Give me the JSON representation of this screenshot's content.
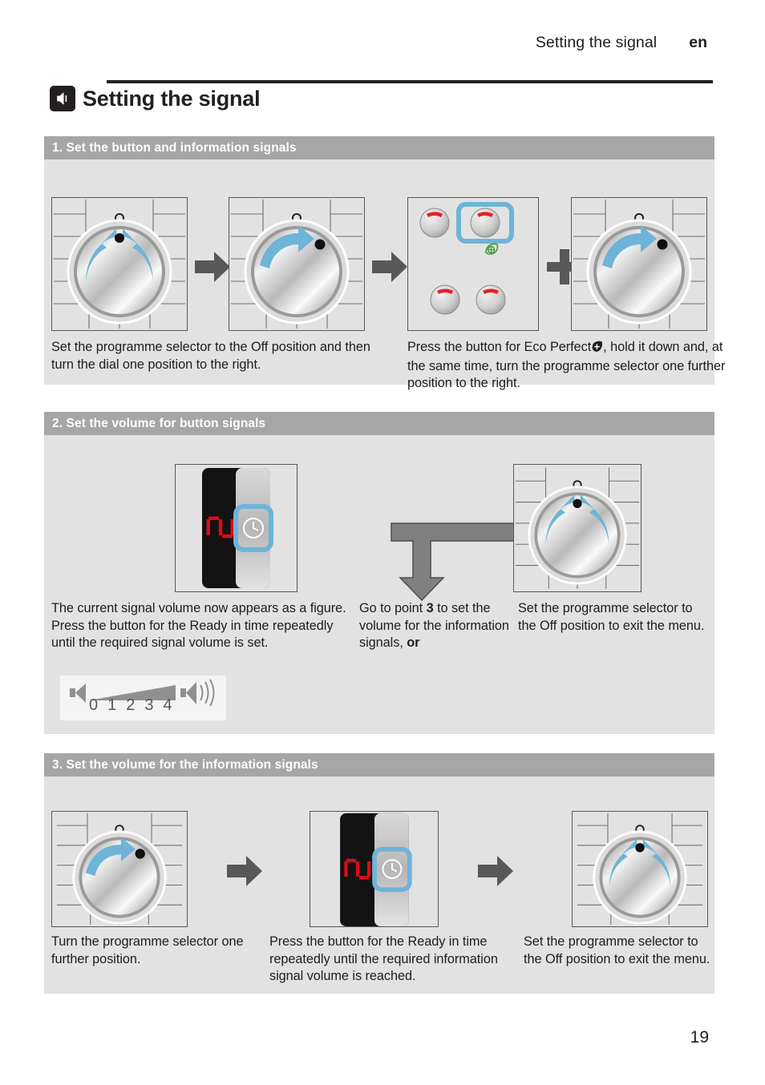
{
  "header": {
    "running_title": "Setting the signal",
    "language": "en"
  },
  "chapter": {
    "title": "Setting the signal",
    "icon": "speaker-icon"
  },
  "sections": [
    {
      "id": "step-1",
      "heading": "1. Set the button and information signals",
      "captions": [
        "Set the programme selector to the Off position and then turn the dial one position to the right.",
        "Press the button for Eco Perfect  , hold it down and, at the same time, turn the programme selector one further position to the right."
      ],
      "caption_right_prefix": "Press the button for Eco Perfect",
      "caption_right_suffix": ", hold it down and, at the same time, turn the programme selector one further position to the right.",
      "figures": [
        {
          "name": "knob-off-position",
          "type": "knob",
          "arrows": "two-converging",
          "marker": "top"
        },
        {
          "name": "knob-one-right",
          "type": "knob",
          "arrows": "single-clockwise",
          "marker": "upper-right"
        },
        {
          "name": "button-panel-eco-perfect",
          "type": "buttons",
          "highlight": "top-right",
          "badge": "eco-perfect-leaf-icon"
        },
        {
          "name": "knob-one-further-right",
          "type": "knob",
          "arrows": "single-clockwise",
          "marker": "upper-right"
        }
      ],
      "connectors": [
        "arrow-right-icon",
        "arrow-right-icon",
        "plus-icon"
      ]
    },
    {
      "id": "step-2",
      "heading": "2. Set the volume for button signals",
      "captions": [
        "The current signal volume now appears as a figure. Press the button for the Ready in time repeatedly until the required signal volume is set.",
        "Go to point 3 to set the volume for the information signals, or",
        "Set the programme selector to the Off position to exit the menu."
      ],
      "caption_mid_parts": {
        "before": "Go to point ",
        "bold_point": "3",
        "after": " to set the volume for the information signals, ",
        "bold_or": "or"
      },
      "display": {
        "name": "signal-volume-display",
        "value": "2",
        "button": "ready-in-time-clock-icon",
        "highlighted": true
      },
      "volume_scale": {
        "name": "volume-scale",
        "min_icon": "speaker-quiet-icon",
        "max_icon": "speaker-loud-icon",
        "levels": [
          "0",
          "1",
          "2",
          "3",
          "4"
        ]
      },
      "connectors": [
        "branch-arrow-icon"
      ]
    },
    {
      "id": "step-3",
      "heading": "3. Set the volume for the information signals",
      "captions": [
        "Turn the programme selector one further position.",
        "Press the button for the Ready in time repeatedly until the required information signal volume is reached.",
        "Set the programme selector to the Off position to exit the menu."
      ],
      "display": {
        "name": "info-signal-volume-display",
        "value": "2",
        "button": "ready-in-time-clock-icon",
        "highlighted": true
      },
      "connectors": [
        "arrow-right-icon",
        "arrow-right-icon"
      ]
    }
  ],
  "footer": {
    "page_number": "19"
  },
  "colors": {
    "section_bg": "#e2e2e2",
    "section_head": "#a6a6a6",
    "accent_blue": "#6eb4d8",
    "arrow_grey": "#58585a",
    "branch_arrow_grey": "#808080",
    "display_black": "#131313",
    "display_red": "#e10a17",
    "button_red": "#e3202a",
    "eco_green": "#3f9c35",
    "text": "#1d1d1d"
  }
}
